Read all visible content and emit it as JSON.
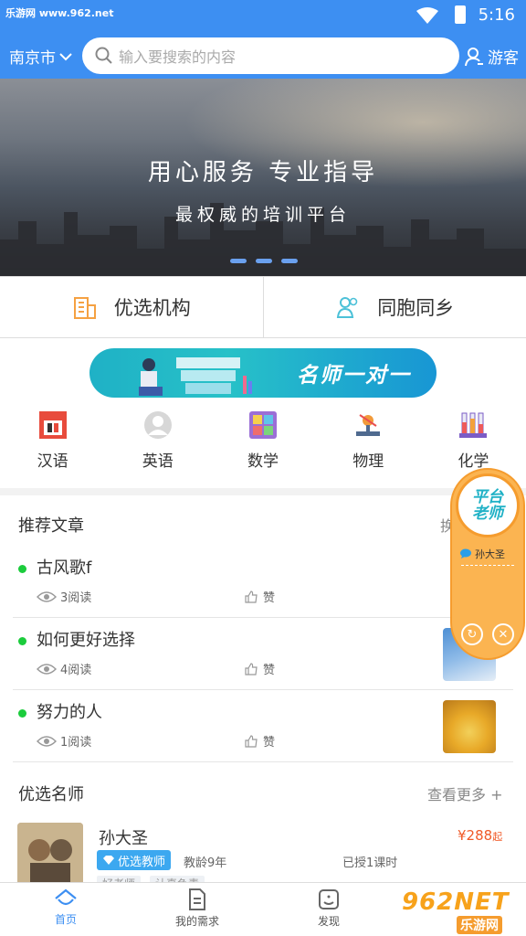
{
  "statusbar": {
    "watermark": "乐游网 www.962.net",
    "time": "5:16"
  },
  "header": {
    "city": "南京市",
    "search_placeholder": "输入要搜索的内容",
    "guest_label": "游客"
  },
  "banner": {
    "headline": "用心服务 专业指导",
    "subline": "最权威的培训平台",
    "slides": 3
  },
  "entries": [
    {
      "label": "优选机构",
      "icon": "building-icon"
    },
    {
      "label": "同胞同乡",
      "icon": "people-icon"
    }
  ],
  "promo": {
    "label": "名师一对一"
  },
  "categories": [
    {
      "label": "汉语",
      "icon": "chinese-book-icon"
    },
    {
      "label": "英语",
      "icon": "user-circle-icon"
    },
    {
      "label": "数学",
      "icon": "calculator-icon"
    },
    {
      "label": "物理",
      "icon": "physics-icon"
    },
    {
      "label": "化学",
      "icon": "test-tubes-icon"
    }
  ],
  "articles_section": {
    "title": "推荐文章",
    "more": "换"
  },
  "articles": [
    {
      "title": "古风歌f",
      "reads": "3阅读",
      "like": "赞"
    },
    {
      "title": "如何更好选择",
      "reads": "4阅读",
      "like": "赞"
    },
    {
      "title": "努力的人",
      "reads": "1阅读",
      "like": "赞"
    }
  ],
  "teachers_section": {
    "title": "优选名师",
    "more": "查看更多 +"
  },
  "teacher": {
    "name": "孙大圣",
    "badge": "优选教师",
    "years": "教龄9年",
    "taught": "已授1课时",
    "price": "¥288",
    "price_suffix": "起",
    "tags": [
      "好老师",
      "认真负责"
    ]
  },
  "float_widget": {
    "logo_line1": "平台",
    "logo_line2": "老师",
    "teacher": "孙大圣"
  },
  "bottomnav": [
    {
      "label": "首页",
      "icon": "home-icon",
      "active": true
    },
    {
      "label": "我的需求",
      "icon": "document-icon",
      "active": false
    },
    {
      "label": "发现",
      "icon": "discover-icon",
      "active": false
    }
  ],
  "site_watermark": {
    "big": "962NET",
    "small": "乐游网"
  },
  "colors": {
    "primary": "#3d8ff2",
    "accent_orange": "#f59c2e",
    "price": "#f05a28",
    "online_dot": "#1bcc3c"
  }
}
